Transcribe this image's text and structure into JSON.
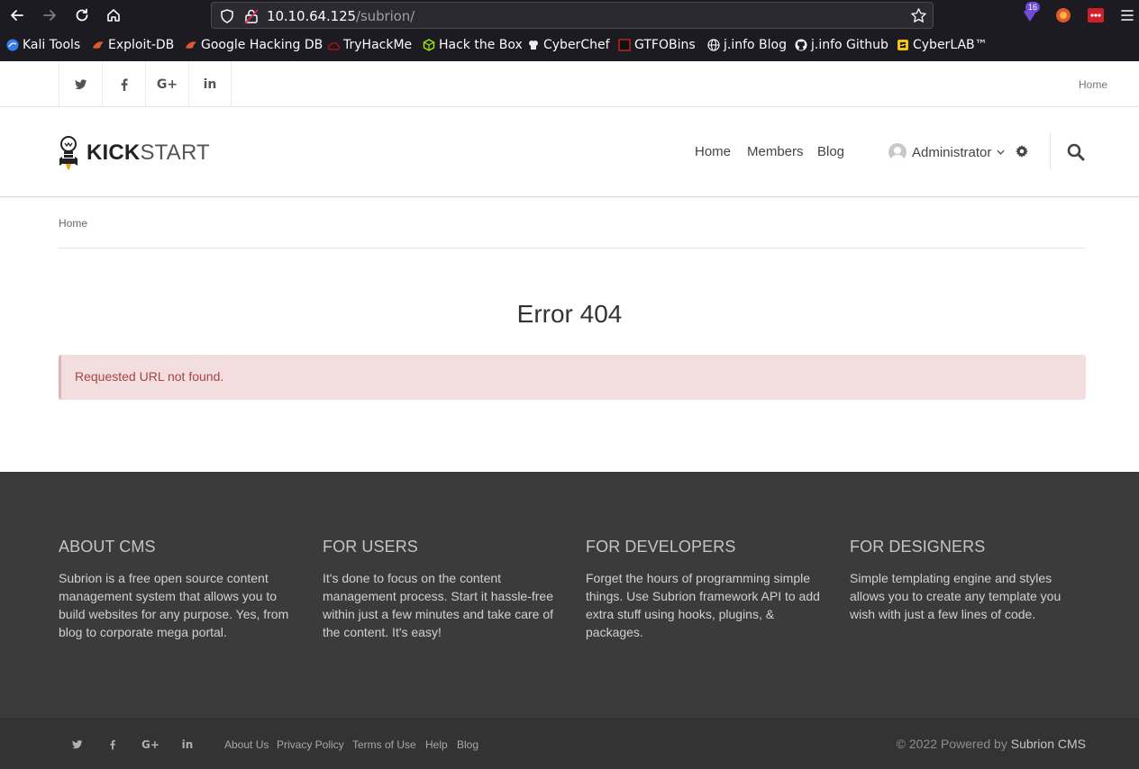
{
  "browser": {
    "url_host": "10.10.64.125",
    "url_path": "/subrion/",
    "ext_badge": "16",
    "bookmarks": [
      "Kali Tools",
      "Exploit-DB",
      "Google Hacking DB",
      "TryHackMe",
      "Hack the Box",
      "CyberChef",
      "GTFOBins",
      "j.info Blog",
      "j.info Github",
      "CyberLAB™"
    ]
  },
  "topbar": {
    "social": [
      "twitter-icon",
      "facebook-icon",
      "google-plus-icon",
      "linkedin-icon"
    ],
    "home_link": "Home"
  },
  "header": {
    "logo_bold": "KICK",
    "logo_light": "START",
    "nav": [
      "Home",
      "Members",
      "Blog"
    ],
    "user": "Administrator"
  },
  "breadcrumb": "Home",
  "main": {
    "title": "Error 404",
    "alert": "Requested URL not found."
  },
  "footer": {
    "columns": [
      {
        "title": "About CMS",
        "text": "Subrion is a free open source content management system that allows you to build websites for any purpose. Yes, from blog to corporate mega portal."
      },
      {
        "title": "For Users",
        "text": "It's done to focus on the content management process. Start it hassle-free within just a few minutes and take care of the content. It's easy!"
      },
      {
        "title": "For Developers",
        "text": "Forget the hours of programming simple things. Use Subrion framework API to add extra stuff using hooks, plugins, & packages."
      },
      {
        "title": "For Designers",
        "text": "Simple templating engine and styles allows you to create any template you wish with just a few lines of code."
      }
    ],
    "links": [
      "About Us",
      "Privacy Policy",
      "Terms of Use",
      "Help",
      "Blog"
    ],
    "copyright_prefix": "© 2022 Powered by",
    "copyright_brand": "Subrion CMS"
  },
  "colors": {
    "browser_bg": "#1c1b22",
    "footer_bg": "#3b3b3b",
    "footer_bottom_bg": "#333333",
    "alert_bg": "#f2dede",
    "alert_text": "#a94442"
  }
}
